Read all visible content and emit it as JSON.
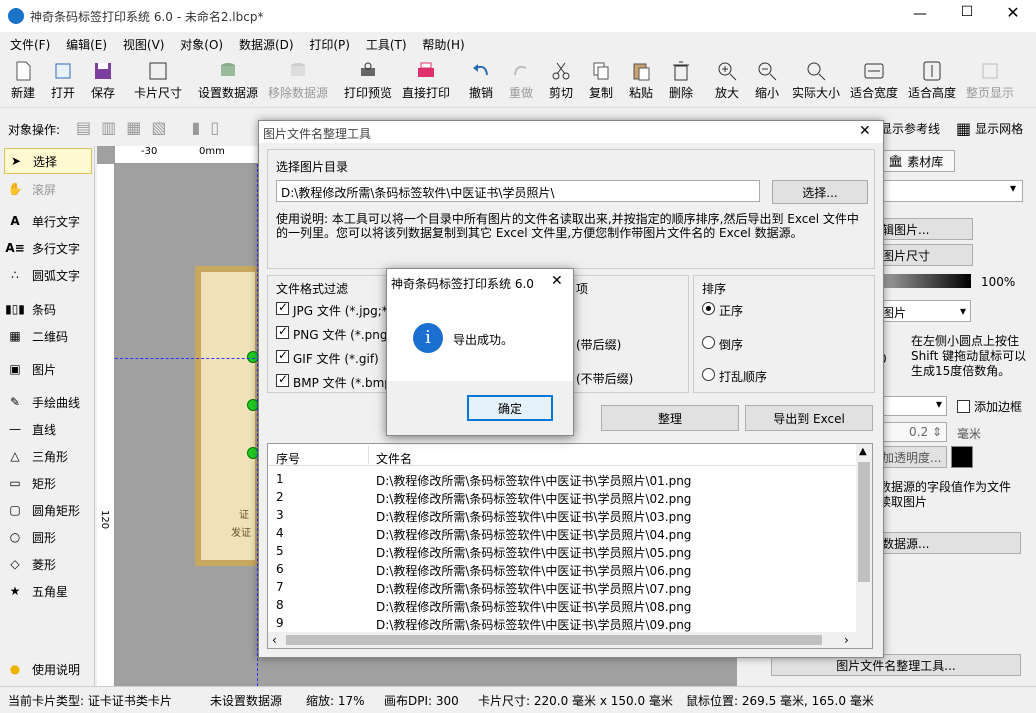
{
  "window": {
    "title": "神奇条码标签打印系统 6.0 - 未命名2.lbcp*"
  },
  "menu": [
    "文件(F)",
    "编辑(E)",
    "视图(V)",
    "对象(O)",
    "数据源(D)",
    "打印(P)",
    "工具(T)",
    "帮助(H)"
  ],
  "toolbar": [
    {
      "label": "新建",
      "icon": "new-icon"
    },
    {
      "label": "打开",
      "icon": "open-icon"
    },
    {
      "label": "保存",
      "icon": "save-icon"
    },
    {
      "label": "卡片尺寸",
      "icon": "card-size-icon"
    },
    {
      "label": "设置数据源",
      "icon": "database-icon"
    },
    {
      "label": "移除数据源",
      "icon": "remove-database-icon"
    },
    {
      "label": "打印预览",
      "icon": "print-preview-icon"
    },
    {
      "label": "直接打印",
      "icon": "print-icon"
    },
    {
      "label": "撤销",
      "icon": "undo-icon"
    },
    {
      "label": "重做",
      "icon": "redo-icon"
    },
    {
      "label": "剪切",
      "icon": "cut-icon"
    },
    {
      "label": "复制",
      "icon": "copy-icon"
    },
    {
      "label": "粘贴",
      "icon": "paste-icon"
    },
    {
      "label": "删除",
      "icon": "delete-icon"
    },
    {
      "label": "放大",
      "icon": "zoom-in-icon"
    },
    {
      "label": "缩小",
      "icon": "zoom-out-icon"
    },
    {
      "label": "实际大小",
      "icon": "actual-size-icon"
    },
    {
      "label": "适合宽度",
      "icon": "fit-width-icon"
    },
    {
      "label": "适合高度",
      "icon": "fit-height-icon"
    },
    {
      "label": "整页显示",
      "icon": "full-page-icon"
    }
  ],
  "objbar": {
    "label": "对象操作:",
    "show_guides": "显示参考线",
    "show_grid": "显示网格"
  },
  "leftpanel": [
    "选择",
    "滚屏",
    "单行文字",
    "多行文字",
    "圆弧文字",
    "条码",
    "二维码",
    "图片",
    "手绘曲线",
    "直线",
    "三角形",
    "矩形",
    "圆角矩形",
    "圆形",
    "菱形",
    "五角星",
    "使用说明"
  ],
  "ruler": {
    "h": [
      "-30",
      "0mm"
    ],
    "v": [
      "120"
    ]
  },
  "rightpanel": {
    "tab": "素材库",
    "edit_image": "辑图片...",
    "image_size": "图片尺寸",
    "percent": "100%",
    "fit_select": "图片",
    "hint": "在左侧小圆点上按住 Shift 键拖动鼠标可以生成15度倍数角。",
    "hint_num": "0",
    "add_border": "添加边框",
    "spin_value": "0.2",
    "spin_unit": "毫米",
    "transparency": "加透明度...",
    "datasource_hint": "数据源的字段值作为文件读取图片",
    "datasource_btn": "数据源...",
    "tool_btn": "图片文件名整理工具..."
  },
  "certificate": {
    "line1": "证",
    "line2": "发证"
  },
  "status": {
    "card_type": "当前卡片类型: 证卡证书类卡片",
    "datasource": "未设置数据源",
    "zoom": "缩放: 17%",
    "dpi": "画布DPI: 300",
    "card_size": "卡片尺寸: 220.0 毫米 x 150.0 毫米",
    "mouse": "鼠标位置: 269.5 毫米, 165.0 毫米"
  },
  "dialog": {
    "title": "图片文件名整理工具",
    "dir_label": "选择图片目录",
    "dir_value": "D:\\教程修改所需\\条码标签软件\\中医证书\\学员照片\\",
    "choose_btn": "选择...",
    "instructions": "使用说明: 本工具可以将一个目录中所有图片的文件名读取出来,并按指定的顺序排序,然后导出到 Excel 文件中的一列里。您可以将该列数据复制到其它 Excel 文件里,方便您制作带图片文件名的 Excel 数据源。",
    "filter_label": "文件格式过滤",
    "filters": [
      "JPG 文件 (*.jpg;*",
      "PNG 文件 (*.png)",
      "GIF 文件 (*.gif)",
      "BMP 文件 (*.bmp"
    ],
    "options_label": "项",
    "opt1": "(带后缀)",
    "opt2": "(不带后缀)",
    "sort_label": "排序",
    "sort": [
      "正序",
      "倒序",
      "打乱顺序"
    ],
    "sort_btn": "整理",
    "export_btn": "导出到 Excel",
    "table": {
      "headers": [
        "序号",
        "文件名"
      ],
      "rows": [
        [
          "1",
          "D:\\教程修改所需\\条码标签软件\\中医证书\\学员照片\\01.png"
        ],
        [
          "2",
          "D:\\教程修改所需\\条码标签软件\\中医证书\\学员照片\\02.png"
        ],
        [
          "3",
          "D:\\教程修改所需\\条码标签软件\\中医证书\\学员照片\\03.png"
        ],
        [
          "4",
          "D:\\教程修改所需\\条码标签软件\\中医证书\\学员照片\\04.png"
        ],
        [
          "5",
          "D:\\教程修改所需\\条码标签软件\\中医证书\\学员照片\\05.png"
        ],
        [
          "6",
          "D:\\教程修改所需\\条码标签软件\\中医证书\\学员照片\\06.png"
        ],
        [
          "7",
          "D:\\教程修改所需\\条码标签软件\\中医证书\\学员照片\\07.png"
        ],
        [
          "8",
          "D:\\教程修改所需\\条码标签软件\\中医证书\\学员照片\\08.png"
        ],
        [
          "9",
          "D:\\教程修改所需\\条码标签软件\\中医证书\\学员照片\\09.png"
        ]
      ]
    }
  },
  "msgbox": {
    "title": "神奇条码标签打印系统 6.0",
    "text": "导出成功。",
    "ok": "确定"
  }
}
